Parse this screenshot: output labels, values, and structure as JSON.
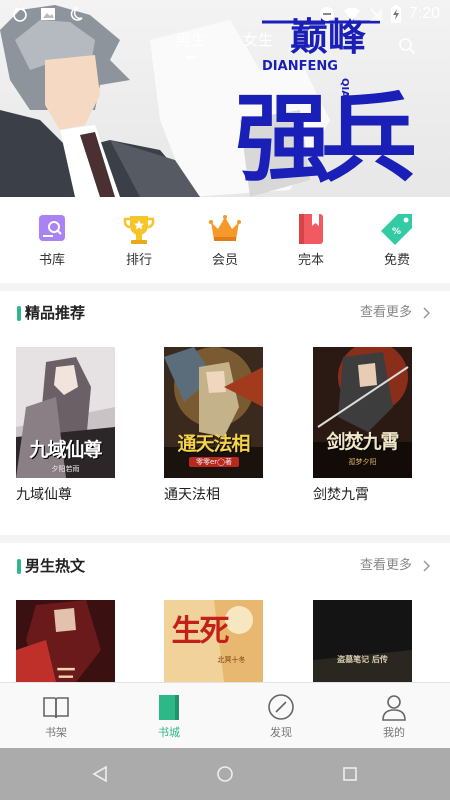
{
  "status_bar": {
    "time": "7:20",
    "left_icons": [
      "cat-face-icon",
      "image-icon",
      "moon-icon"
    ],
    "right_icons": [
      "minus-circle-icon",
      "wifi-icon",
      "no-signal-icon",
      "battery-charging-icon"
    ]
  },
  "top_tabs": [
    {
      "label": "男生",
      "active": true
    },
    {
      "label": "女生",
      "active": false
    }
  ],
  "banner": {
    "title_top": "巅峰",
    "title_main": "强兵",
    "pinyin_row": "DIANFENG",
    "pinyin_col": "QIANGBING"
  },
  "categories": [
    {
      "label": "书库",
      "icon": "library-search-icon",
      "color": "#9b6cf0"
    },
    {
      "label": "排行",
      "icon": "trophy-icon",
      "color": "#f6c527"
    },
    {
      "label": "会员",
      "icon": "crown-icon",
      "color": "#f59a2a"
    },
    {
      "label": "完本",
      "icon": "bookmark-book-icon",
      "color": "#f25a61"
    },
    {
      "label": "免费",
      "icon": "price-tag-icon",
      "color": "#32cba4"
    }
  ],
  "sections": [
    {
      "title": "精品推荐",
      "more": "查看更多",
      "books": [
        {
          "name": "九域仙尊",
          "cover_title": "九域仙尊",
          "cover_author": "夕阳若雨"
        },
        {
          "name": "通天法相",
          "cover_title": "通天法相",
          "cover_author": "零零er◯著"
        },
        {
          "name": "剑焚九霄",
          "cover_title": "剑焚九霄",
          "cover_author": "孤梦夕阳"
        }
      ]
    },
    {
      "title": "男生热文",
      "more": "查看更多",
      "books": [
        {
          "cover_title": "三"
        },
        {
          "cover_title": "生死",
          "cover_author": "北冥十冬"
        },
        {
          "cover_title": "盗墓笔记 后传"
        }
      ]
    }
  ],
  "bottom_nav": [
    {
      "label": "书架",
      "icon": "bookshelf-icon",
      "active": false
    },
    {
      "label": "书城",
      "icon": "bookstore-icon",
      "active": true
    },
    {
      "label": "发现",
      "icon": "compass-icon",
      "active": false
    },
    {
      "label": "我的",
      "icon": "profile-icon",
      "active": false
    }
  ],
  "colors": {
    "accent": "#2fb887",
    "banner_title": "#1a1fb8",
    "system_nav": "#ababab"
  }
}
